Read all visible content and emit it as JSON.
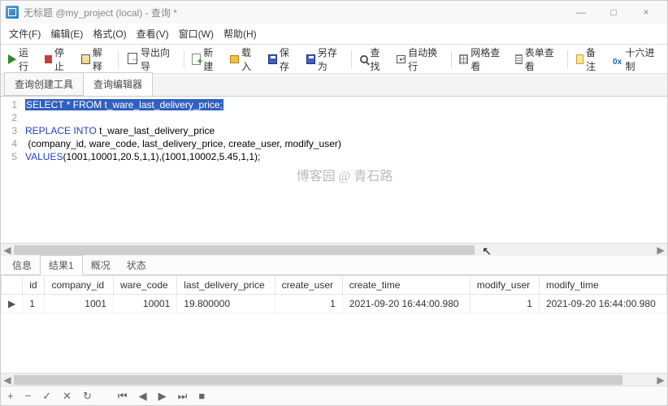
{
  "window": {
    "title": "无标题 @my_project (local) - 查询 *",
    "min": "—",
    "max": "□",
    "close": "×"
  },
  "menu": {
    "file": "文件(F)",
    "edit": "编辑(E)",
    "format": "格式(O)",
    "view": "查看(V)",
    "window": "窗口(W)",
    "help": "帮助(H)"
  },
  "toolbar": {
    "run": "运行",
    "stop": "停止",
    "explain": "解释",
    "export_wizard": "导出向导",
    "new": "新建",
    "load": "载入",
    "save": "保存",
    "save_as": "另存为",
    "find": "查找",
    "auto_wrap": "自动换行",
    "grid_view": "网格查看",
    "form_view": "表单查看",
    "notes": "备注",
    "hex": "十六进制"
  },
  "tabs": {
    "builder": "查询创建工具",
    "editor": "查询编辑器"
  },
  "code": {
    "l1_a": "SELECT * FROM t_ware_last_delivery_price;",
    "l2": "",
    "l3_kw": "REPLACE INTO",
    "l3_rest": " t_ware_last_delivery_price",
    "l4": " (company_id, ware_code, last_delivery_price, create_user, modify_user)",
    "l5_kw": "VALUES",
    "l5_rest": "(1001,10001,20.5,1,1),(1001,10002,5.45,1,1);"
  },
  "watermark": "博客园 @ 青石路",
  "lower_tabs": {
    "info": "信息",
    "result1": "结果1",
    "profile": "概况",
    "status": "状态"
  },
  "columns": [
    "id",
    "company_id",
    "ware_code",
    "last_delivery_price",
    "create_user",
    "create_time",
    "modify_user",
    "modify_time"
  ],
  "row": {
    "id": "1",
    "company_id": "1001",
    "ware_code": "10001",
    "last_delivery_price": "19.800000",
    "create_user": "1",
    "create_time": "2021-09-20 16:44:00.980",
    "modify_user": "1",
    "modify_time": "2021-09-20 16:44:00.980"
  },
  "nav": {
    "add": "+",
    "remove": "−",
    "confirm": "✓",
    "cancel": "✕",
    "refresh": "↻",
    "first": "⏮",
    "prev": "◀",
    "next": "▶",
    "last": "⏭",
    "stop": "■"
  }
}
